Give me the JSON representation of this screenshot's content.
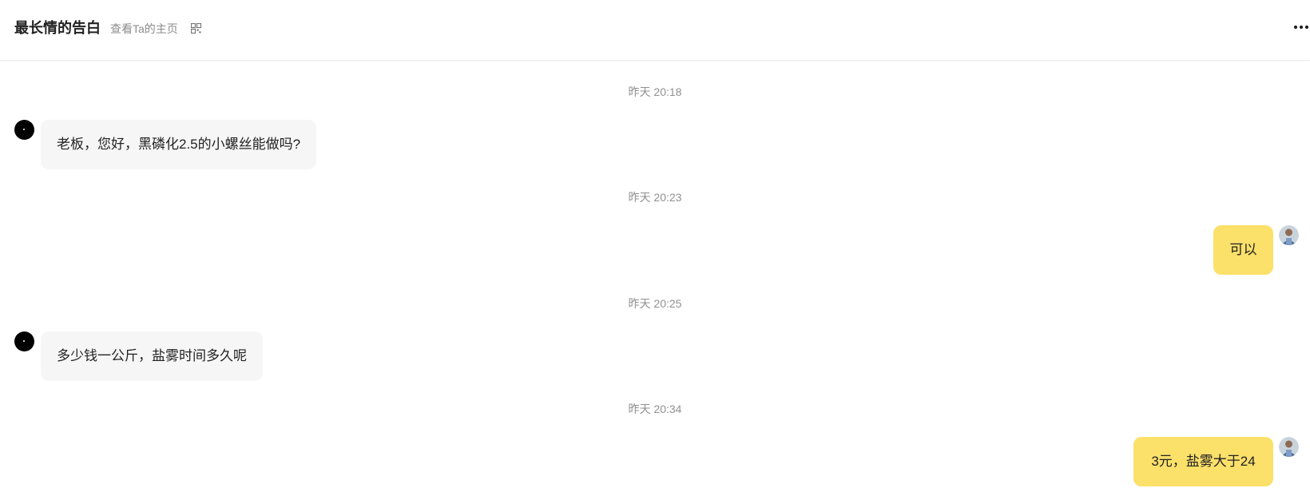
{
  "header": {
    "title": "最长情的告白",
    "profile_link": "查看Ta的主页",
    "qr_icon": "qr-code-icon",
    "more_icon": "more-horizontal-icon"
  },
  "messages": [
    {
      "time": "昨天 20:18",
      "side": "left",
      "text": "老板，您好，黑磷化2.5的小螺丝能做吗?"
    },
    {
      "time": "昨天 20:23",
      "side": "right",
      "text": "可以"
    },
    {
      "time": "昨天 20:25",
      "side": "left",
      "text": "多少钱一公斤，盐雾时间多久呢"
    },
    {
      "time": "昨天 20:34",
      "side": "right",
      "text": "3元，盐雾大于24"
    }
  ],
  "colors": {
    "incoming_bubble": "#f6f6f6",
    "outgoing_bubble": "#fbe06a",
    "timestamp": "#909090"
  }
}
